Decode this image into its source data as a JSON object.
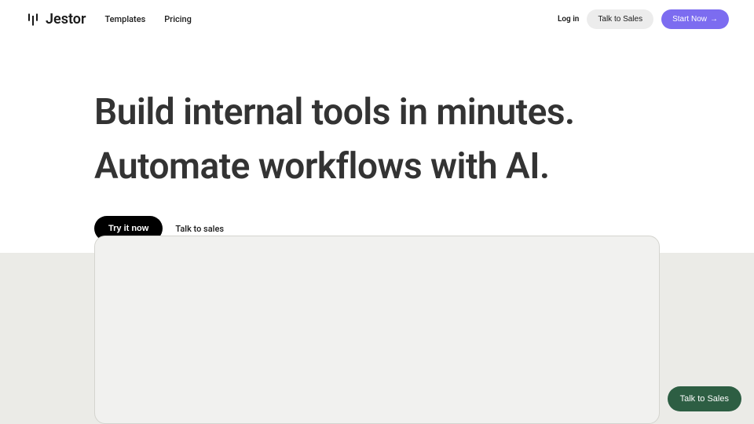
{
  "brand": "Jestor",
  "nav": {
    "templates": "Templates",
    "pricing": "Pricing"
  },
  "header": {
    "login": "Log in",
    "talk_to_sales": "Talk to Sales",
    "start_now": "Start Now"
  },
  "hero": {
    "title_line1": "Build internal tools in minutes.",
    "title_line2": "Automate workflows with AI."
  },
  "cta": {
    "try_it_now": "Try it now",
    "talk_to_sales": "Talk to sales"
  },
  "floating": {
    "talk_to_sales": "Talk to Sales"
  }
}
